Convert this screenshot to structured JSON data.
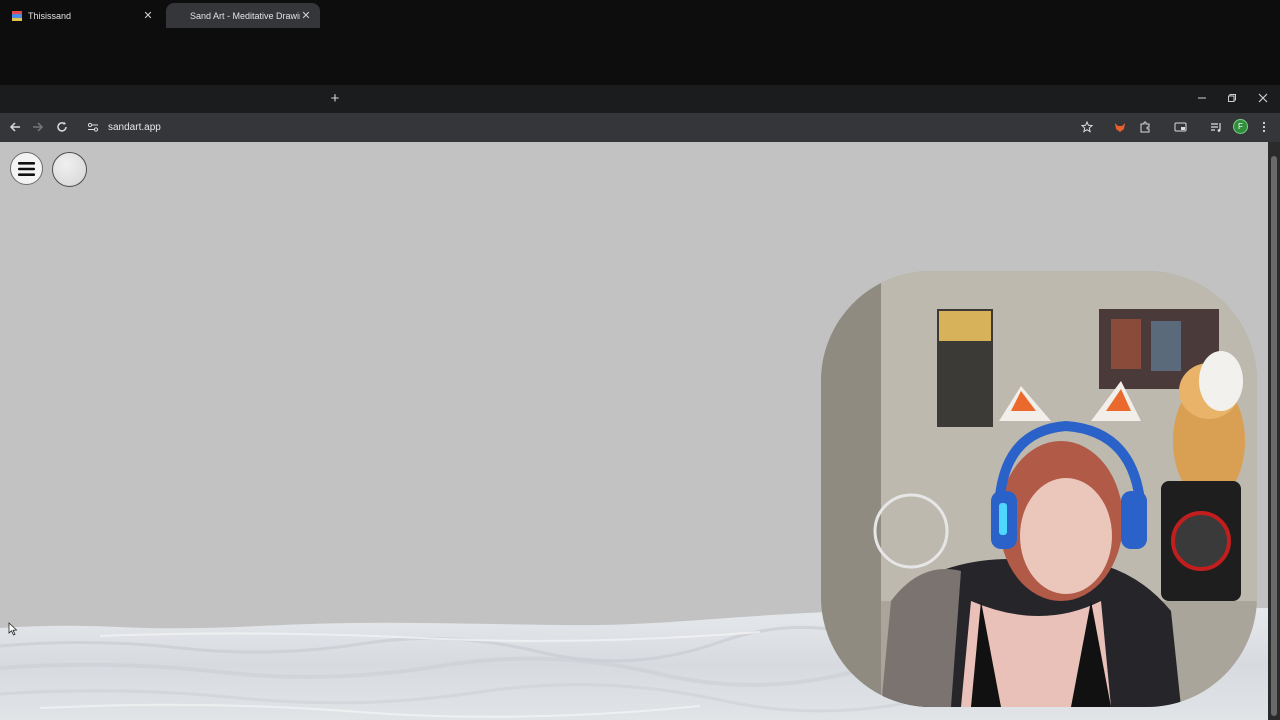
{
  "browser": {
    "tabs": [
      {
        "title": "Thisissand",
        "active": false
      },
      {
        "title": "Sand Art - Meditative Drawing",
        "active": true
      }
    ],
    "address_bar": {
      "url": "sandart.app"
    },
    "profile_initial": "F"
  },
  "icons": {
    "tab1_favicon": "thisissand-logo-icon",
    "back": "arrow-left-icon",
    "forward": "arrow-right-icon",
    "reload": "reload-icon",
    "site_info": "site-settings-icon",
    "bookmark": "star-icon",
    "extension": "fox-extension-icon",
    "extensions": "puzzle-icon",
    "reading": "cast-icon",
    "media": "media-queue-icon",
    "menu": "kebab-menu-icon",
    "app_menu": "hamburger-icon"
  },
  "colors": {
    "canvas_bg": "#c2c2c2",
    "sand": "#dcdfe3",
    "chrome_dark": "#1b1c1e",
    "chrome_toolbar": "#35363a",
    "profile_green": "#2f8f3b"
  },
  "webcam": {
    "description_hidden": true
  }
}
